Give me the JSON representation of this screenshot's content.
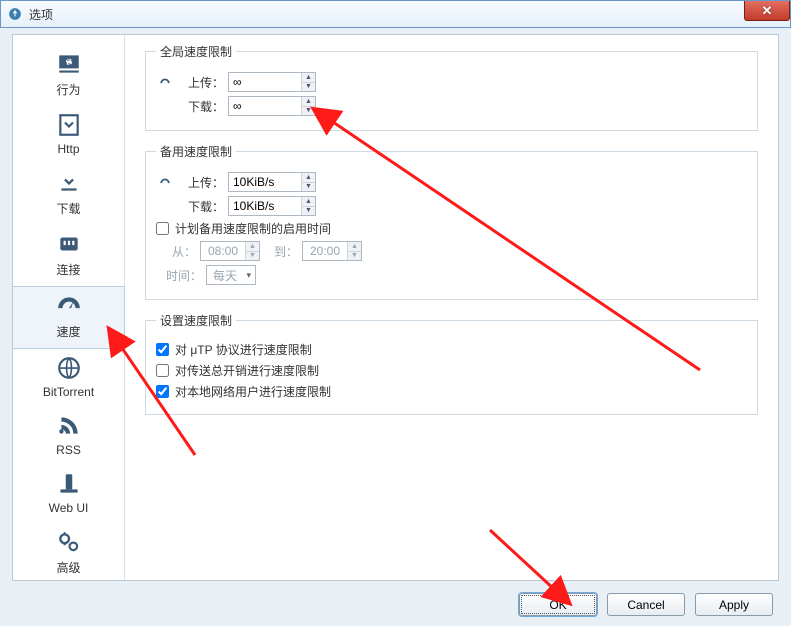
{
  "window": {
    "title": "选项"
  },
  "sidebar": {
    "items": [
      {
        "key": "behavior",
        "label": "行为"
      },
      {
        "key": "http",
        "label": "Http"
      },
      {
        "key": "download",
        "label": "下载"
      },
      {
        "key": "connect",
        "label": "连接"
      },
      {
        "key": "speed",
        "label": "速度"
      },
      {
        "key": "bt",
        "label": "BitTorrent"
      },
      {
        "key": "rss",
        "label": "RSS"
      },
      {
        "key": "webui",
        "label": "Web UI"
      },
      {
        "key": "advanced",
        "label": "高级"
      }
    ],
    "selected": "speed"
  },
  "global_limit": {
    "legend": "全局速度限制",
    "upload_label": "上传：",
    "upload_value": "∞",
    "download_label": "下载：",
    "download_value": "∞"
  },
  "alt_limit": {
    "legend": "备用速度限制",
    "upload_label": "上传：",
    "upload_value": "10KiB/s",
    "download_label": "下载：",
    "download_value": "10KiB/s",
    "schedule_checkbox": "计划备用速度限制的启用时间",
    "schedule_checked": false,
    "from_label": "从：",
    "from_value": "08:00",
    "to_label": "到：",
    "to_value": "20:00",
    "time_label": "时间：",
    "time_value": "每天"
  },
  "set_limit": {
    "legend": "设置速度限制",
    "opt_utp": {
      "label": "对 μTP 协议进行速度限制",
      "checked": true
    },
    "opt_overhead": {
      "label": "对传送总开销进行速度限制",
      "checked": false
    },
    "opt_lan": {
      "label": "对本地网络用户进行速度限制",
      "checked": true
    }
  },
  "buttons": {
    "ok": "OK",
    "cancel": "Cancel",
    "apply": "Apply"
  }
}
